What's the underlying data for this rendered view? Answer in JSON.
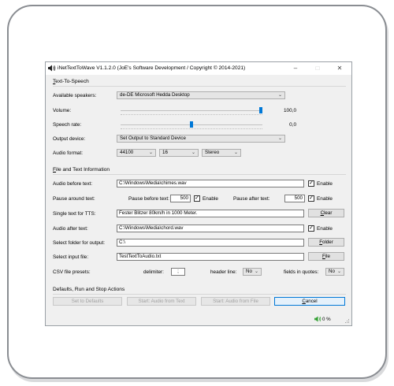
{
  "window": {
    "title": "iNetTextToWave V1.1.2.0 (JoE's Software Development / Copyright ©  2014-2021)",
    "minimize": "–",
    "maximize": "□",
    "close": "✕"
  },
  "tts": {
    "section_prefix": "T",
    "section_rest": "ext-To-Speech",
    "speakers_label": "Available speakers:",
    "speakers_value": "de-DE Microsoft Hedda Desktop",
    "volume_label": "Volume:",
    "volume_value": "100,0",
    "volume_level": 1.0,
    "rate_label": "Speech rate:",
    "rate_value": "0,0",
    "rate_level": 0.5,
    "output_label": "Output device:",
    "output_value": "Set Output to Standard Device",
    "format_label": "Audio format:",
    "format_rate": "44100",
    "format_bits": "16",
    "format_channels": "Stereo"
  },
  "file": {
    "section_prefix": "F",
    "section_rest": "ile and Text Information",
    "audio_before_label": "Audio before text:",
    "audio_before_value": "C:\\Windows\\Media\\chimes.wav",
    "audio_before_enable": "Enable",
    "pause_around_label": "Pause around text:",
    "pause_before_label": "Pause before text:",
    "pause_before_value": "500",
    "pause_before_enable": "Enable",
    "pause_after_label": "Pause after text:",
    "pause_after_value": "500",
    "pause_after_enable": "Enable",
    "single_text_label": "Single text for TTS:",
    "single_text_value": "Fester Blitzer 80km/h in 1000 Meter.",
    "clear_button_prefix": "C",
    "clear_button_rest": "lear",
    "audio_after_label": "Audio after text:",
    "audio_after_value": "C:\\Windows\\Media\\chord.wav",
    "audio_after_enable": "Enable",
    "folder_label": "Select folder for output:",
    "folder_value": "C:\\",
    "folder_button_prefix": "F",
    "folder_button_rest": "older",
    "input_file_label": "Select input file:",
    "input_file_value": "TestTextToAudio.txt",
    "file_button_prefix": "F",
    "file_button_rest": "ile",
    "csv_label": "CSV file presets:",
    "delimiter_label": "delimiter:",
    "delimiter_value": ";",
    "header_label": "header line:",
    "header_value": "No",
    "quotes_label": "fields in quotes:",
    "quotes_value": "No"
  },
  "actions": {
    "section_text": "Defaults, Run and Stop Actions",
    "defaults_button": "Set to Defaults",
    "audio_text_button": "Start: Audio from Text",
    "audio_file_button": "Start: Audio from File",
    "cancel_button_prefix": "C",
    "cancel_button_rest": "ancel"
  },
  "status": {
    "progress_text": "0 %"
  },
  "colors": {
    "accent": "#0078d7",
    "status_green": "#2e9e2e"
  }
}
